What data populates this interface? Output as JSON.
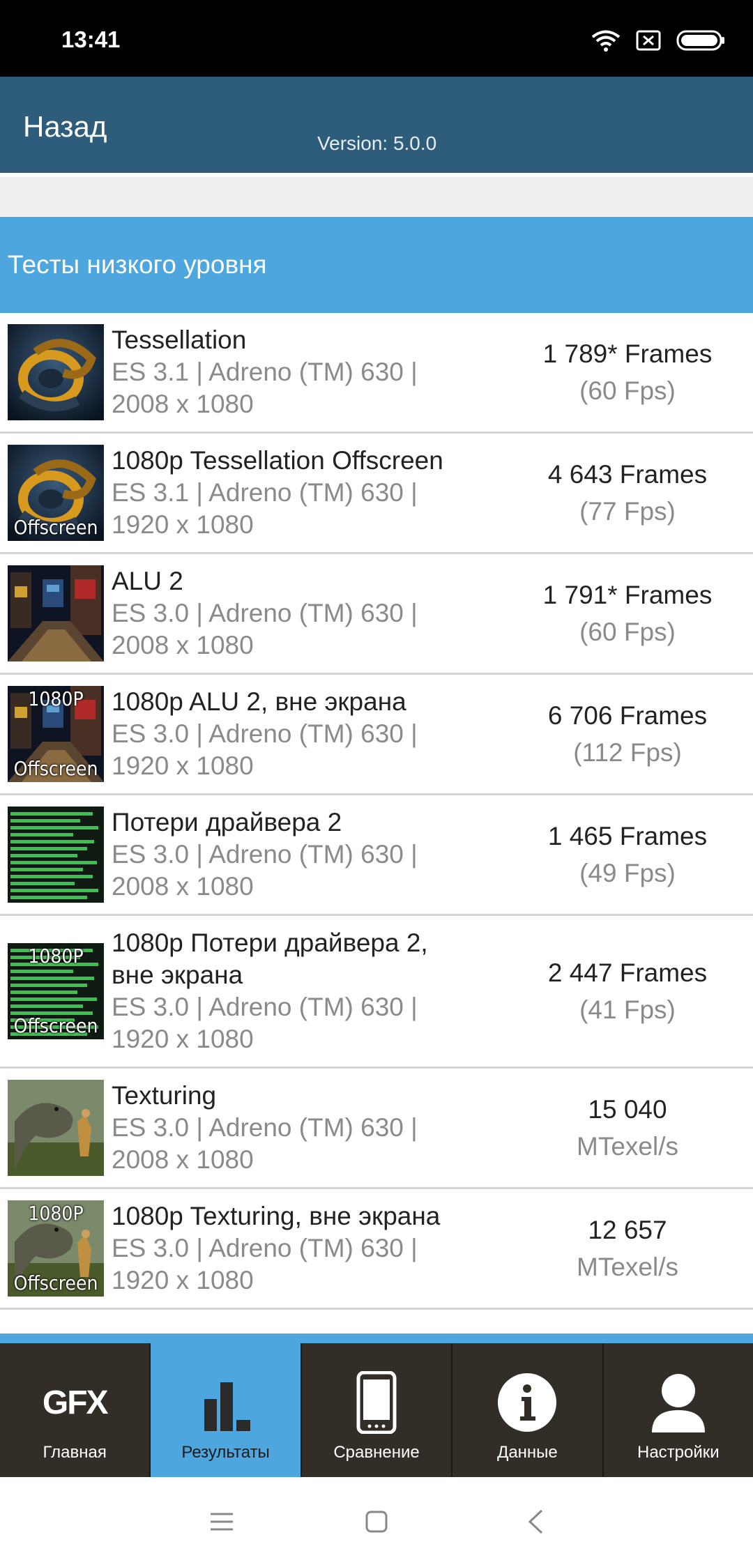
{
  "status": {
    "time": "13:41",
    "icons": [
      "wifi-icon",
      "no-sim-icon",
      "battery-icon"
    ]
  },
  "header": {
    "back_label": "Назад",
    "version_label": "Version: 5.0.0",
    "color": "#2e5c7b"
  },
  "section": {
    "title": "Тесты низкого уровня",
    "color": "#4ea6df"
  },
  "results": [
    {
      "thumb": "tessellation",
      "badge_top": "",
      "badge_bottom": "",
      "title_lines": [
        "Tessellation"
      ],
      "desc_lines": [
        "ES 3.1 | Adreno (TM) 630 |",
        "2008 x 1080"
      ],
      "score_main": "1 789* Frames",
      "score_sub": "(60 Fps)"
    },
    {
      "thumb": "tessellation",
      "badge_top": "",
      "badge_bottom": "Offscreen",
      "title_lines": [
        "1080p Tessellation Offscreen"
      ],
      "desc_lines": [
        "ES 3.1 | Adreno (TM) 630 |",
        "1920 x 1080"
      ],
      "score_main": "4 643 Frames",
      "score_sub": "(77 Fps)"
    },
    {
      "thumb": "alu",
      "badge_top": "",
      "badge_bottom": "",
      "title_lines": [
        "ALU 2"
      ],
      "desc_lines": [
        "ES 3.0 | Adreno (TM) 630 |",
        "2008 x 1080"
      ],
      "score_main": "1 791* Frames",
      "score_sub": "(60 Fps)"
    },
    {
      "thumb": "alu",
      "badge_top": "1080P",
      "badge_bottom": "Offscreen",
      "title_lines": [
        "1080p ALU 2, вне экрана"
      ],
      "desc_lines": [
        "ES 3.0 | Adreno (TM) 630 |",
        "1920 x 1080"
      ],
      "score_main": "6 706 Frames",
      "score_sub": "(112 Fps)"
    },
    {
      "thumb": "driver",
      "badge_top": "",
      "badge_bottom": "",
      "title_lines": [
        "Потери драйвера 2"
      ],
      "desc_lines": [
        "ES 3.0 | Adreno (TM) 630 |",
        "2008 x 1080"
      ],
      "score_main": "1 465 Frames",
      "score_sub": "(49 Fps)"
    },
    {
      "thumb": "driver",
      "badge_top": "1080P",
      "badge_bottom": "Offscreen",
      "title_lines": [
        "1080p Потери драйвера 2,",
        "вне экрана"
      ],
      "desc_lines": [
        "ES 3.0 | Adreno (TM) 630 |",
        "1920 x 1080"
      ],
      "score_main": "2 447 Frames",
      "score_sub": "(41 Fps)"
    },
    {
      "thumb": "texturing",
      "badge_top": "",
      "badge_bottom": "",
      "title_lines": [
        "Texturing"
      ],
      "desc_lines": [
        "ES 3.0 | Adreno (TM) 630 |",
        "2008 x 1080"
      ],
      "score_main": "15 040",
      "score_sub": "MTexel/s"
    },
    {
      "thumb": "texturing",
      "badge_top": "1080P",
      "badge_bottom": "Offscreen",
      "title_lines": [
        "1080p Texturing, вне экрана"
      ],
      "desc_lines": [
        "ES 3.0 | Adreno (TM) 630 |",
        "1920 x 1080"
      ],
      "score_main": "12 657",
      "score_sub": "MTexel/s"
    }
  ],
  "tabs": [
    {
      "label": "Главная",
      "icon": "gfx-logo-icon",
      "logo_text": "GFX",
      "active": false
    },
    {
      "label": "Результаты",
      "icon": "bar-chart-icon",
      "active": true
    },
    {
      "label": "Сравнение",
      "icon": "phone-icon",
      "active": false
    },
    {
      "label": "Данные",
      "icon": "info-icon",
      "active": false
    },
    {
      "label": "Настройки",
      "icon": "user-icon",
      "active": false
    }
  ],
  "system_nav": [
    "menu-icon",
    "home-icon",
    "back-icon"
  ]
}
